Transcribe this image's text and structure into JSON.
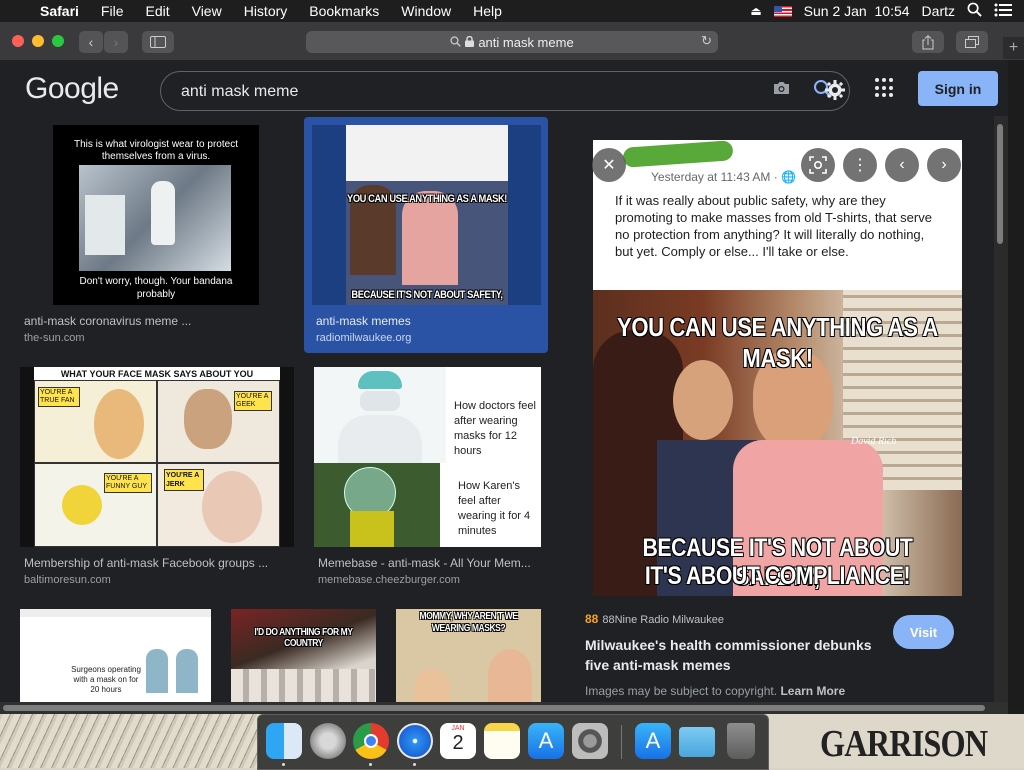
{
  "menubar": {
    "app": "Safari",
    "items": [
      "File",
      "Edit",
      "View",
      "History",
      "Bookmarks",
      "Window",
      "Help"
    ],
    "datetime": "Sun 2 Jan  10:54",
    "user": "Dartz"
  },
  "browser": {
    "url": "anti mask meme"
  },
  "google": {
    "logo": "Google",
    "query": "anti mask meme",
    "signin": "Sign in"
  },
  "results": [
    {
      "caption": "anti-mask coronavirus meme ...",
      "domain": "the-sun.com",
      "text_top": "This is what virologist wear to protect themselves from a virus.",
      "text_bottom": "Don't worry, though. Your bandana probably"
    },
    {
      "caption": "anti-mask memes",
      "domain": "radiomilwaukee.org",
      "text_top": "YOU CAN USE ANYTHING AS A MASK!",
      "text_bottom": "BECAUSE IT'S NOT ABOUT SAFETY,"
    },
    {
      "caption": "Membership of anti-mask Facebook groups ...",
      "domain": "baltimoresun.com",
      "text_top": "WHAT YOUR FACE MASK SAYS ABOUT YOU",
      "labels": [
        "YOU'RE A TRUE FAN",
        "YOU'RE A GEEK",
        "YOU'RE A FUNNY GUY",
        "YOU'RE A JERK"
      ]
    },
    {
      "caption": "Memebase - anti-mask - All Your Mem...",
      "domain": "memebase.cheezburger.com",
      "text_top": "How doctors feel after wearing masks for 12 hours",
      "text_bottom": "How Karen's feel after wearing it for 4 minutes"
    },
    {
      "text": "Surgeons operating with a mask on for 20 hours"
    },
    {
      "text": "I'D DO ANYTHING FOR MY COUNTRY"
    },
    {
      "text": "MOMMY, WHY AREN'T WE WEARING MASKS?"
    }
  ],
  "panel": {
    "post_time": "Yesterday at 11:43 AM · ",
    "post_text": "If it was really about public safety, why are they promoting to make masses from old T-shirts, that serve no protection from anything? It will literally do nothing, but yet. Comply or else... I'll take or else.",
    "meme_top": "YOU CAN USE ANYTHING AS A MASK!",
    "meme_bottom_1": "BECAUSE IT'S NOT ABOUT SAFETY,",
    "meme_bottom_2": "IT'S ABOUT COMPLIANCE!",
    "signature": "David Rich",
    "source_badge": "88",
    "source": "88Nine Radio Milwaukee",
    "title_1": "Milwaukee's health commissioner debunks",
    "title_2": "five anti-mask memes",
    "visit": "Visit",
    "copyright": "Images may be subject to copyright. ",
    "learn_more": "Learn More"
  },
  "desktop": {
    "wallpaper_text": "GARRISON"
  },
  "dock": {
    "calendar_month": "JAN",
    "calendar_day": "2"
  }
}
